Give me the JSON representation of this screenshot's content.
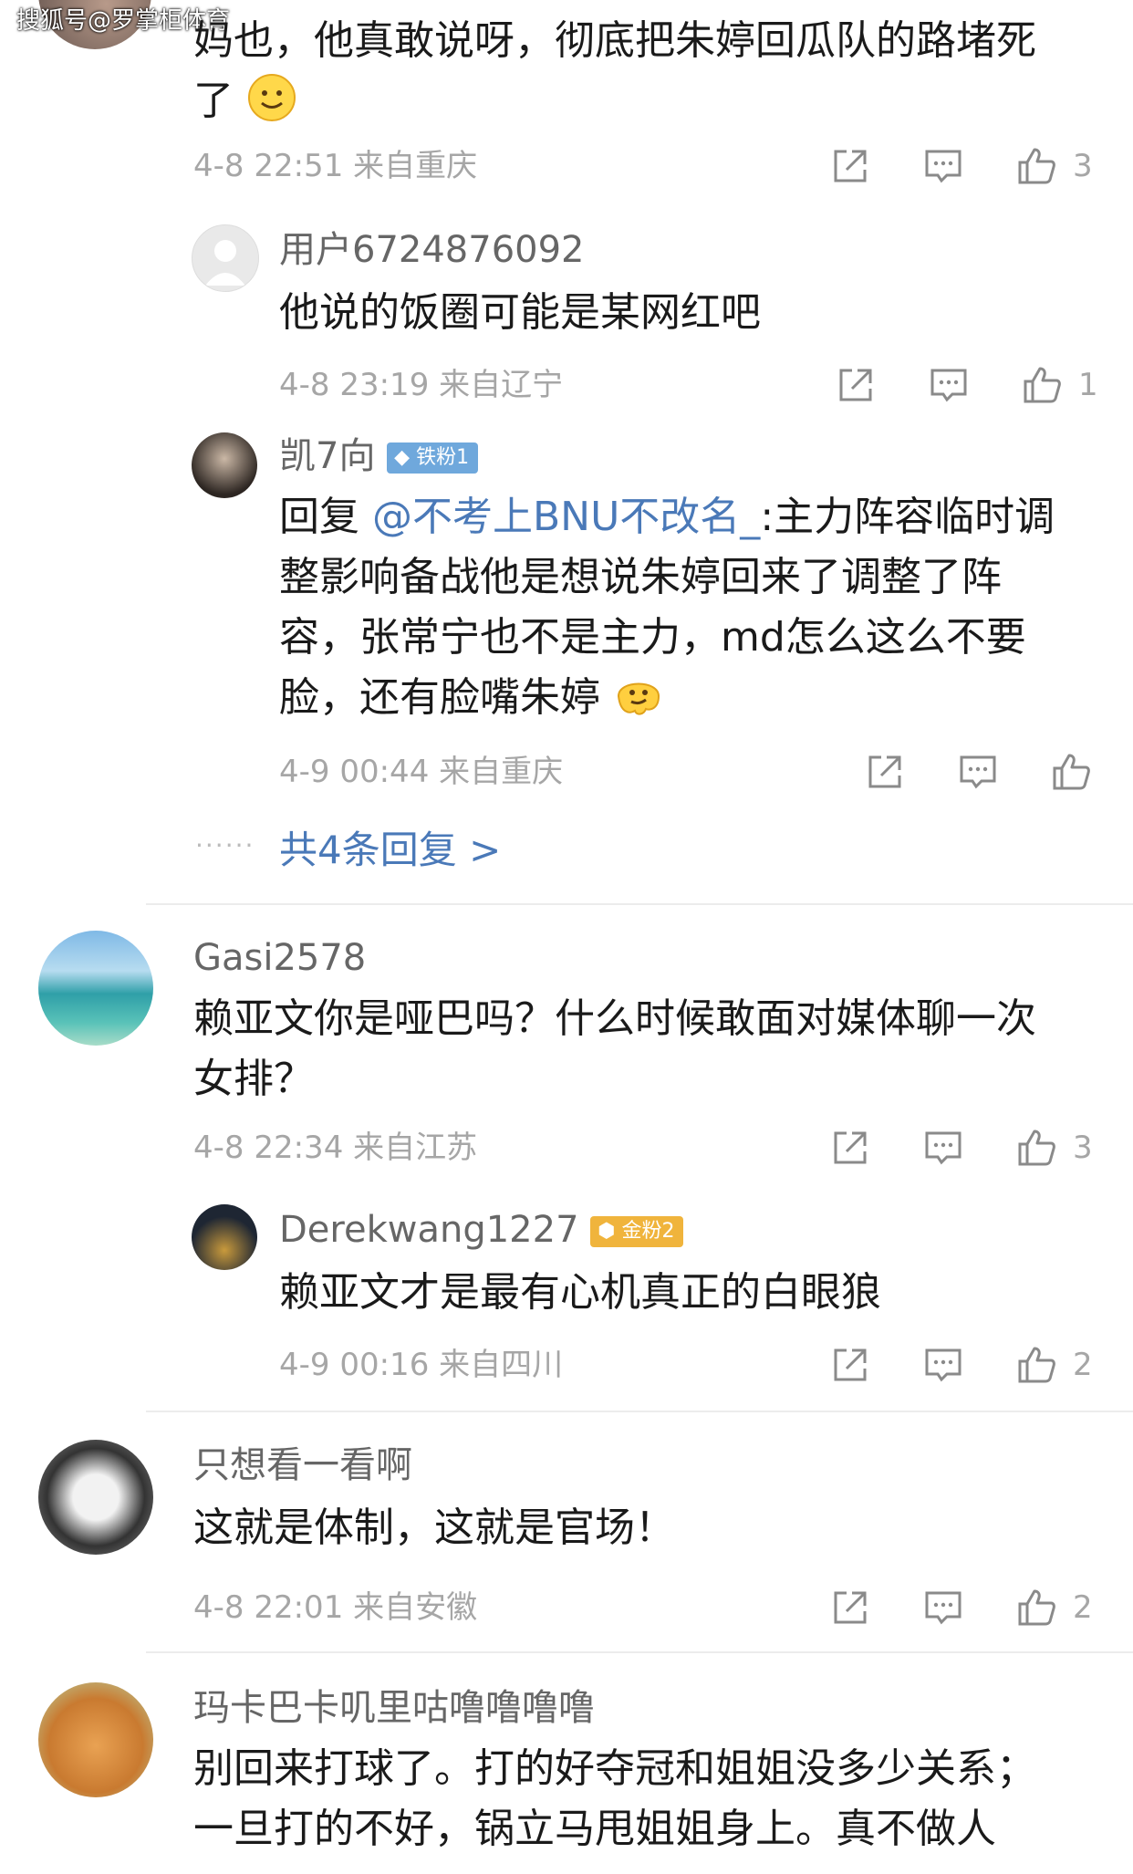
{
  "watermark": "搜狐号@罗掌柜体育",
  "colors": {
    "link": "#4a79b8",
    "meta": "#a6a6a6",
    "name": "#666666",
    "iron_badge": "#6fa8dc",
    "gold_badge": "#f0b43c"
  },
  "c0": {
    "line1": "妈也，他真敢说呀，彻底把朱婷回瓜队的路堵死",
    "line2": "了",
    "time": "4-8 22:51",
    "location": "来自重庆",
    "likes": "3"
  },
  "r1": {
    "name": "用户6724876092",
    "text": "他说的饭圈可能是某网红吧",
    "time": "4-8 23:19",
    "location": "来自辽宁",
    "likes": "1"
  },
  "r2": {
    "name": "凯7向",
    "badge": "铁粉1",
    "reply_prefix": "回复 ",
    "mention": "@不考上BNU不改名_",
    "line1_rest": ":主力阵容临时调",
    "line2": "整影响备战他是想说朱婷回来了调整了阵",
    "line3": "容，张常宁也不是主力，md怎么这么不要",
    "line4": "脸，还有脸嘴朱婷",
    "time": "4-9 00:44",
    "location": "来自重庆"
  },
  "more_replies": "共4条回复 >",
  "c2": {
    "name": "Gasi2578",
    "line1": "赖亚文你是哑巴吗？什么时候敢面对媒体聊一次",
    "line2": "女排？",
    "time": "4-8 22:34",
    "location": "来自江苏",
    "likes": "3"
  },
  "r3": {
    "name": "Derekwang1227",
    "badge": "金粉2",
    "text": "赖亚文才是最有心机真正的白眼狼",
    "time": "4-9 00:16",
    "location": "来自四川",
    "likes": "2"
  },
  "c3": {
    "name": "只想看一看啊",
    "text": "这就是体制，这就是官场！",
    "time": "4-8 22:01",
    "location": "来自安徽",
    "likes": "2"
  },
  "c4": {
    "name": "玛卡巴卡叽里咕噜噜噜噜",
    "line1": "别回来打球了。打的好夺冠和姐姐没多少关系；",
    "line2": "一旦打的不好，锅立马甩姐姐身上。真不做人"
  }
}
